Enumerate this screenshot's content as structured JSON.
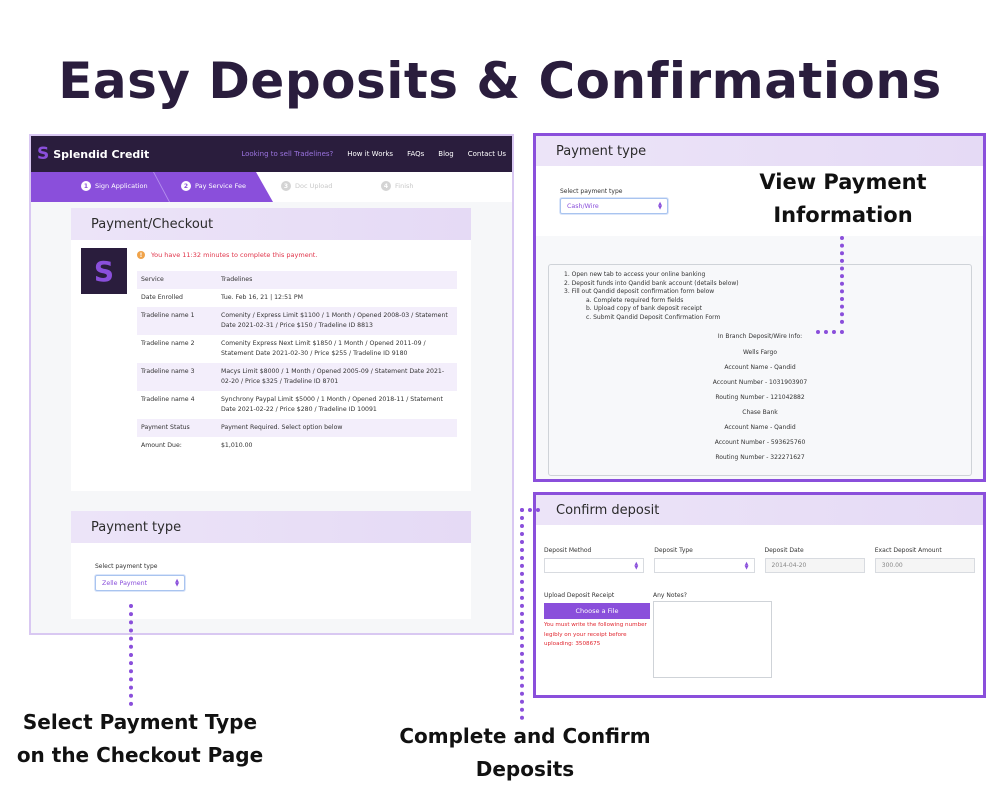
{
  "page_title": "Easy Deposits & Confirmations",
  "left_screenshot": {
    "nav": {
      "brand": "Splendid Credit",
      "links": [
        "Looking to sell Tradelines?",
        "How it Works",
        "FAQs",
        "Blog",
        "Contact Us"
      ]
    },
    "steps": [
      {
        "num": "1",
        "label": "Sign Application",
        "state": "done"
      },
      {
        "num": "2",
        "label": "Pay Service Fee",
        "state": "active"
      },
      {
        "num": "3",
        "label": "Doc Upload",
        "state": "pending"
      },
      {
        "num": "4",
        "label": "Finish",
        "state": "pending"
      }
    ],
    "checkout": {
      "title": "Payment/Checkout",
      "logo_letter": "S",
      "timer_warning": "You have 11:32 minutes to complete this payment.",
      "rows": [
        {
          "label": "Service",
          "value": "Tradelines"
        },
        {
          "label": "Date Enrolled",
          "value": "Tue. Feb 16, 21 | 12:51 PM"
        },
        {
          "label": "Tradeline name 1",
          "value": "Comenity / Express Limit $1100 / 1 Month / Opened 2008-03 / Statement Date 2021-02-31 / Price $150 / Tradeline ID 8813"
        },
        {
          "label": "Tradeline name 2",
          "value": "Comenity Express Next Limit $1850 / 1 Month / Opened 2011-09 / Statement Date 2021-02-30 / Price $255 / Tradeline ID 9180"
        },
        {
          "label": "Tradeline name 3",
          "value": "Macys Limit $8000 / 1 Month / Opened 2005-09 / Statement Date 2021-02-20 / Price $325 / Tradeline ID 8701"
        },
        {
          "label": "Tradeline name 4",
          "value": "Synchrony Paypal Limit $5000 / 1 Month / Opened 2018-11 / Statement Date 2021-02-22 / Price $280 / Tradeline ID 10091"
        },
        {
          "label": "Payment Status",
          "value": "Payment Required. Select option below"
        },
        {
          "label": "Amount Due:",
          "value": "$1,010.00"
        }
      ]
    },
    "payment_type": {
      "title": "Payment type",
      "select_label": "Select payment type",
      "selected": "Zelle Payment"
    }
  },
  "right_top": {
    "title": "Payment type",
    "select_label": "Select payment type",
    "selected": "Cash/Wire",
    "instructions": [
      "1. Open new tab to access your online banking",
      "2. Deposit funds into Qandid bank account (details below)",
      "3. Fill out Qandid deposit confirmation form below"
    ],
    "sub_instructions": [
      "a. Complete required form fields",
      "b. Upload copy of bank deposit receipt",
      "c. Submit Qandid Deposit Confirmation Form"
    ],
    "wire_lines": [
      "In Branch Deposit/Wire Info:",
      "Wells Fargo",
      "Account Name - Qandid",
      "Account Number - 1031903907",
      "Routing Number - 121042882",
      "Chase Bank",
      "Account Name - Qandid",
      "Account Number - 593625760",
      "Routing Number - 322271627"
    ]
  },
  "right_bottom": {
    "title": "Confirm deposit",
    "fields": [
      {
        "label": "Deposit Method",
        "value": "",
        "type": "select"
      },
      {
        "label": "Deposit Type",
        "value": "",
        "type": "select"
      },
      {
        "label": "Deposit Date",
        "value": "2014-04-20",
        "type": "input"
      },
      {
        "label": "Exact Deposit Amount",
        "value": "300.00",
        "type": "input"
      }
    ],
    "upload_label": "Upload Deposit Receipt",
    "upload_button": "Choose a File",
    "upload_note": "You must write the following number legibly on your receipt before uploading: 3508675",
    "notes_label": "Any Notes?"
  },
  "annotations": {
    "view_payment": "View Payment Information",
    "select_type": "Select Payment Type on the Checkout Page",
    "complete_confirm": "Complete and Confirm Deposits"
  },
  "colors": {
    "accent": "#8a4fdb",
    "dark": "#2a1d3d",
    "warning": "#e0344a"
  }
}
